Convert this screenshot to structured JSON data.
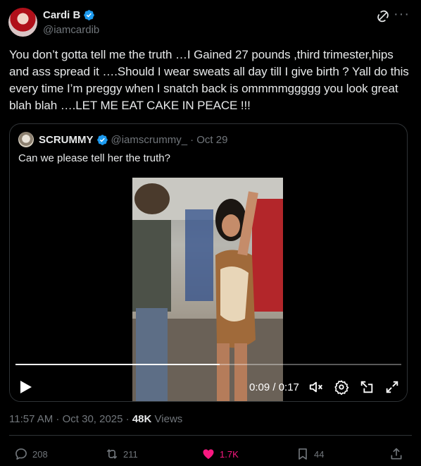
{
  "author": {
    "display_name": "Cardi B",
    "handle": "@iamcardib",
    "verified": true,
    "avatar": "avatar-image"
  },
  "tweet_text": "You don’t gotta tell me the truth …I Gained 27 pounds ,third trimester,hips and ass spread it ….Should I wear sweats all day till I give birth ? Yall do this every time I’m preggy when I snatch back is ommmmggggg you look great blah blah ….LET ME EAT CAKE IN PEACE !!!",
  "quote": {
    "display_name": "SCRUMMY",
    "handle": "@iamscrummy_",
    "date": "· Oct 29",
    "text": "Can we please tell her the truth?",
    "video": {
      "time": "0:09 / 0:17",
      "progress": 0.53
    }
  },
  "meta": {
    "timestamp": "11:57 AM · Oct 30, 2025 ·",
    "views_count": "48K",
    "views_label": "Views"
  },
  "actions": {
    "replies": "208",
    "reposts": "211",
    "likes": "1.7K",
    "bookmarks": "44"
  },
  "colors": {
    "background": "#000000",
    "text": "#e7e9ea",
    "secondary": "#71767b",
    "verified": "#1d9bf0",
    "like": "#f91880",
    "border": "#2f3336"
  },
  "icons": [
    "grok-icon",
    "more-icon",
    "verified-icon",
    "play-icon",
    "mute-icon",
    "settings-icon",
    "popout-icon",
    "fullscreen-icon",
    "reply-icon",
    "repost-icon",
    "like-icon",
    "bookmark-icon",
    "share-icon"
  ]
}
